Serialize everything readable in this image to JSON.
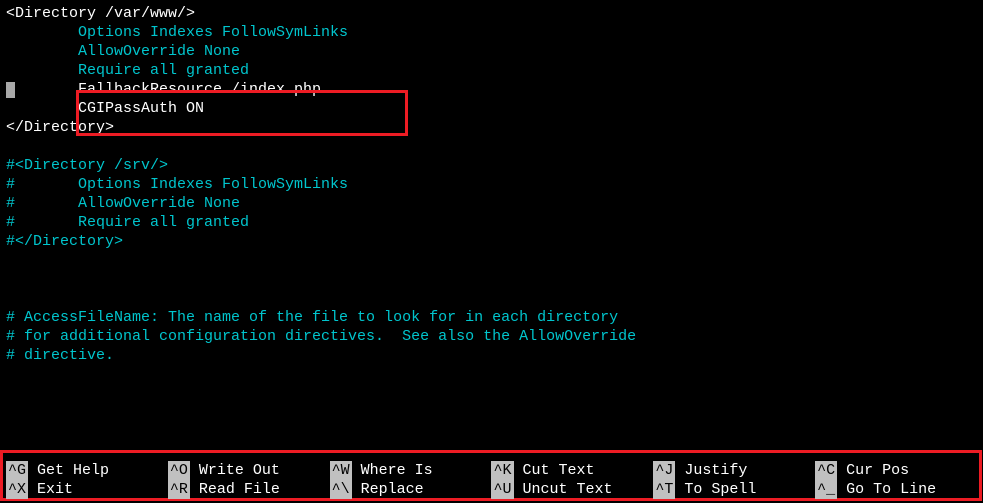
{
  "lines": [
    {
      "color": "white",
      "text": "<Directory /var/www/>"
    },
    {
      "color": "cyan",
      "text": "        Options Indexes FollowSymLinks"
    },
    {
      "color": "cyan",
      "text": "        AllowOverride None"
    },
    {
      "color": "cyan",
      "text": "        Require all granted"
    },
    {
      "color": "white",
      "prefix_cursor": true,
      "text": "       FallbackResource /index.php"
    },
    {
      "color": "white",
      "text": "        CGIPassAuth ON"
    },
    {
      "color": "white",
      "text": "</Directory>"
    },
    {
      "color": "white",
      "text": ""
    },
    {
      "color": "cyan",
      "text": "#<Directory /srv/>"
    },
    {
      "color": "cyan",
      "text": "#       Options Indexes FollowSymLinks"
    },
    {
      "color": "cyan",
      "text": "#       AllowOverride None"
    },
    {
      "color": "cyan",
      "text": "#       Require all granted"
    },
    {
      "color": "cyan",
      "text": "#</Directory>"
    },
    {
      "color": "white",
      "text": ""
    },
    {
      "color": "white",
      "text": ""
    },
    {
      "color": "white",
      "text": ""
    },
    {
      "color": "cyan",
      "text": "# AccessFileName: The name of the file to look for in each directory"
    },
    {
      "color": "cyan",
      "text": "# for additional configuration directives.  See also the AllowOverride"
    },
    {
      "color": "cyan",
      "text": "# directive."
    }
  ],
  "shortcuts": [
    {
      "key": "^G",
      "label": "Get Help"
    },
    {
      "key": "^O",
      "label": "Write Out"
    },
    {
      "key": "^W",
      "label": "Where Is"
    },
    {
      "key": "^K",
      "label": "Cut Text"
    },
    {
      "key": "^J",
      "label": "Justify"
    },
    {
      "key": "^C",
      "label": "Cur Pos"
    },
    {
      "key": "^X",
      "label": "Exit"
    },
    {
      "key": "^R",
      "label": "Read File"
    },
    {
      "key": "^\\",
      "label": "Replace"
    },
    {
      "key": "^U",
      "label": "Uncut Text"
    },
    {
      "key": "^T",
      "label": "To Spell"
    },
    {
      "key": "^_",
      "label": "Go To Line"
    }
  ]
}
